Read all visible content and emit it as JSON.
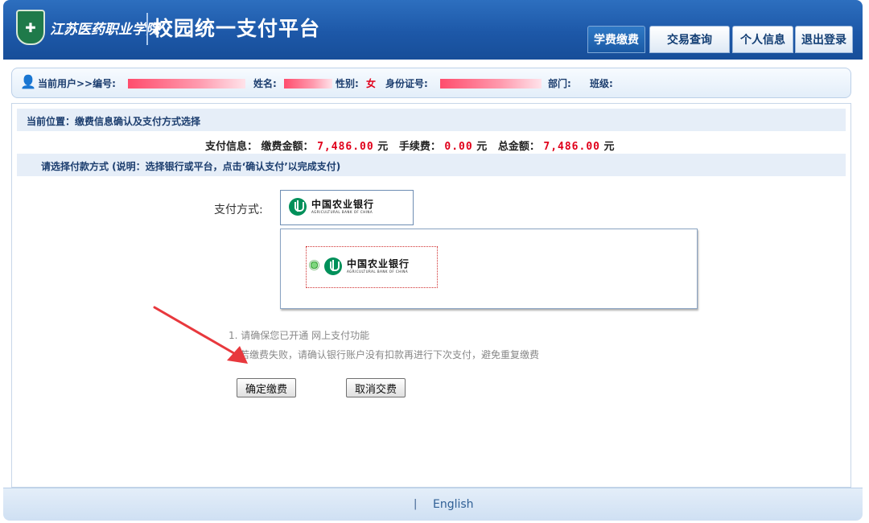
{
  "header": {
    "school_name": "江苏医药职业学院",
    "platform_title": "校园统一支付平台",
    "nav": [
      {
        "label": "学费缴费",
        "active": true
      },
      {
        "label": "交易查询",
        "active": false
      },
      {
        "label": "个人信息",
        "active": false
      },
      {
        "label": "退出登录",
        "active": false
      }
    ]
  },
  "userbar": {
    "prefix": "当前用户>>编号:",
    "name_label": "姓名:",
    "gender_label": "性别:",
    "gender_value": "女",
    "id_label": "身份证号:",
    "dept_label": "部门:",
    "class_label": "班级:"
  },
  "location": "当前位置：缴费信息确认及支付方式选择",
  "pay_info": {
    "label": "支付信息：",
    "amount_label": "缴费金额：",
    "amount": "7,486.00",
    "fee_label": "手续费：",
    "fee": "0.00",
    "total_label": "总金额：",
    "total": "7,486.00",
    "unit": "元"
  },
  "choose_hint": "请选择付款方式 (说明：选择银行或平台，点击‘确认支付’以完成支付)",
  "payment_method_label": "支付方式:",
  "bank": {
    "name_cn": "中国农业银行",
    "name_en": "AGRICULTURAL BANK OF CHINA",
    "selected": true
  },
  "notes": [
    "1. 请确保您已开通 网上支付功能",
    "若缴费失败，请确认银行账户没有扣款再进行下次支付，避免重复缴费"
  ],
  "buttons": {
    "confirm": "确定缴费",
    "cancel": "取消交费"
  },
  "footer": {
    "separator": "|",
    "language": "English"
  },
  "colors": {
    "header_blue": "#1d58a8",
    "amount_red": "#e0001b",
    "bank_green": "#00905a",
    "annotation_arrow": "#e8383d"
  }
}
